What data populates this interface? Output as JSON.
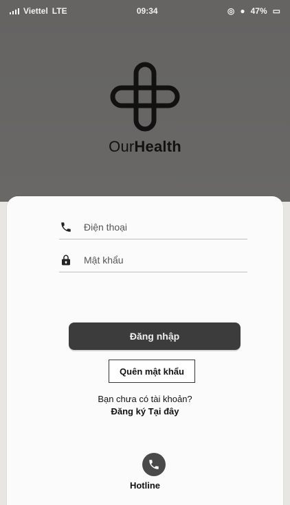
{
  "status": {
    "carrier": "Viettel",
    "network": "LTE",
    "time": "09:34",
    "battery": "47%"
  },
  "brand": {
    "prefix": "Our",
    "emphasis": "Health"
  },
  "form": {
    "phone_placeholder": "Điện thoại",
    "password_placeholder": "Mật khẩu",
    "login_label": "Đăng nhập",
    "forgot_label": "Quên mật khẩu"
  },
  "signup": {
    "question": "Bạn chưa có tài khoản?",
    "link": "Đăng ký Tại đây"
  },
  "hotline": {
    "label": "Hotline"
  },
  "colors": {
    "header_bg": "#6b6a69",
    "card_bg": "#fbfbfb",
    "primary_button": "#3c3c3c"
  },
  "icons": {
    "phone": "phone-icon",
    "lock": "lock-icon",
    "call": "call-icon"
  }
}
